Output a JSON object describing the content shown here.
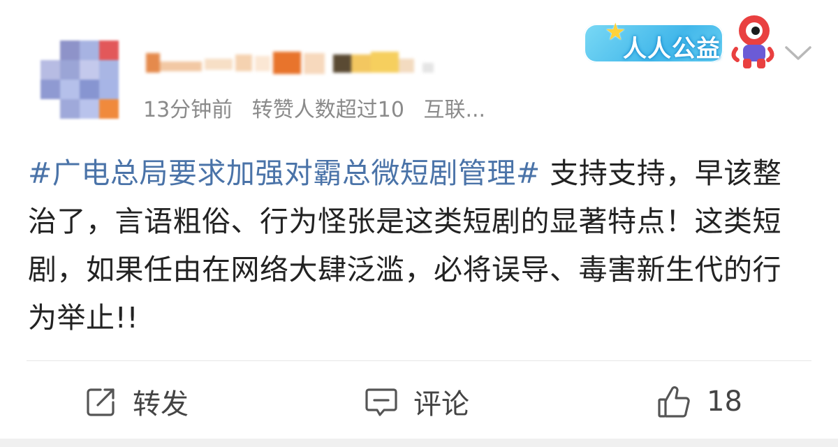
{
  "post": {
    "time": "13分钟前",
    "repost_note": "转赞人数超过10",
    "source": "互联...",
    "hashtag": "#广电总局要求加强对霸总微短剧管理#",
    "body": " 支持支持，早该整治了，言语粗俗、行为怪张是这类短剧的显著特点！这类短剧，如果任由在网络大肆泛滥，必将误导、毒害新生代的行为举止!!"
  },
  "badge": {
    "label": "人人公益"
  },
  "actions": {
    "repost_label": "转发",
    "comment_label": "评论",
    "like_count": "18"
  },
  "icons": {
    "repost": "repost-icon",
    "comment": "comment-icon",
    "like": "thumbs-up-icon",
    "menu": "chevron-down-icon",
    "badge_mascot": "mascot-icon"
  },
  "colors": {
    "hashtag": "#4a73a8",
    "meta_text": "#8a8a8a",
    "body_text": "#222222",
    "badge": "#42b7ea"
  }
}
